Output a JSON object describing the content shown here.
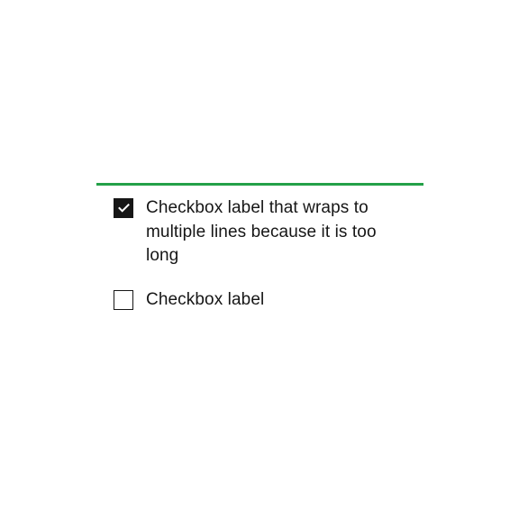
{
  "divider": {
    "color": "#24a148"
  },
  "checkboxes": [
    {
      "checked": true,
      "label": "Checkbox label that wraps to multiple lines because it is too long"
    },
    {
      "checked": false,
      "label": "Checkbox label"
    }
  ]
}
